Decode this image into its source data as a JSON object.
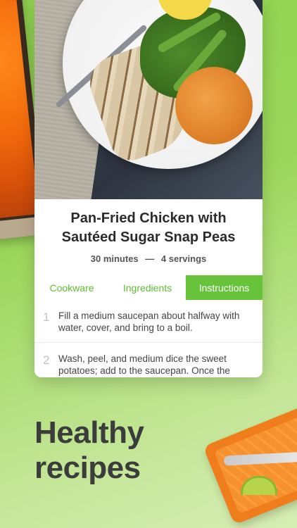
{
  "recipe": {
    "title": "Pan-Fried Chicken with Sautéed Sugar Snap Peas",
    "duration": "30 minutes",
    "separator": "—",
    "servings": "4 servings"
  },
  "tabs": [
    {
      "label": "Cookware",
      "active": false
    },
    {
      "label": "Ingredients",
      "active": false
    },
    {
      "label": "Instructions",
      "active": true
    }
  ],
  "steps": [
    {
      "number": "1",
      "text": "Fill a medium saucepan about halfway with water, cover, and bring to a boil."
    },
    {
      "number": "2",
      "text": "Wash, peel, and medium dice the sweet potatoes; add to the saucepan. Once the water is boiling, cook until the potatoes are"
    }
  ],
  "headline": {
    "line1": "Healthy",
    "line2": "recipes"
  },
  "colors": {
    "accent": "#66c33a",
    "background": "#9ad65a",
    "orange": "#f07d1c"
  }
}
